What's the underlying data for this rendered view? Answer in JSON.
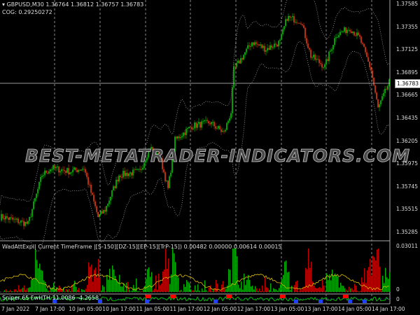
{
  "header": {
    "symbol_line": "GBPUSD,M30  1.36764 1.36812 1.36757 1.36783",
    "cog_line": "COG: 0.29250272"
  },
  "current_price": "1.36783",
  "price_axis": [
    "1.37585",
    "1.37355",
    "1.37125",
    "1.36895",
    "1.36665",
    "1.36435",
    "1.36205",
    "1.35975",
    "1.35745",
    "1.35515",
    "1.35285"
  ],
  "indicator1": {
    "label": "WadAttExpl| Current TimeFrame |[S-150][DZ-15][EP-15][TrP-15]) 0.00482 0.00000 0.00614 0.00015",
    "max": "0.03011",
    "zero": "0"
  },
  "indicator2": {
    "label": "Sniper 65 FwHTH  11.0086  -4.2658",
    "axis": "0"
  },
  "time_axis": [
    "7 Jan 2022",
    "7 Jan 17:00",
    "10 Jan 05:00",
    "10 Jan 17:00",
    "11 Jan 05:00",
    "11 Jan 17:00",
    "12 Jan 05:00",
    "12 Jan 17:00",
    "13 Jan 05:00",
    "13 Jan 17:00",
    "14 Jan 05:00",
    "14 Jan 17:00"
  ],
  "watermark": "BEST-METATRADER-INDICATORS.COM",
  "price_path": [
    [
      2,
      1.35433
    ],
    [
      20,
      1.35363
    ],
    [
      30,
      1.35857
    ],
    [
      37,
      1.35927
    ],
    [
      50,
      1.35892
    ],
    [
      60,
      1.35927
    ],
    [
      70,
      1.35433
    ],
    [
      75,
      1.35504
    ],
    [
      85,
      1.35857
    ],
    [
      100,
      1.35892
    ],
    [
      107,
      1.36139
    ],
    [
      115,
      1.35998
    ],
    [
      120,
      1.35715
    ],
    [
      125,
      1.36209
    ],
    [
      137,
      1.3635
    ],
    [
      150,
      1.36386
    ],
    [
      160,
      1.3628
    ],
    [
      165,
      1.36492
    ],
    [
      167,
      1.36915
    ],
    [
      180,
      1.37197
    ],
    [
      190,
      1.37126
    ],
    [
      200,
      1.37197
    ],
    [
      205,
      1.37444
    ],
    [
      215,
      1.37409
    ],
    [
      222,
      1.37056
    ],
    [
      232,
      1.3695
    ],
    [
      240,
      1.37268
    ],
    [
      250,
      1.37338
    ],
    [
      257,
      1.37232
    ],
    [
      265,
      1.36915
    ],
    [
      270,
      1.36527
    ],
    [
      278,
      1.36788
    ]
  ],
  "colors": {
    "bull": "#00c800",
    "bear": "#e03c14",
    "grid": "#888888",
    "hist_up": "#00b000",
    "hist_down": "#c00000",
    "signal": "#e0c000"
  }
}
